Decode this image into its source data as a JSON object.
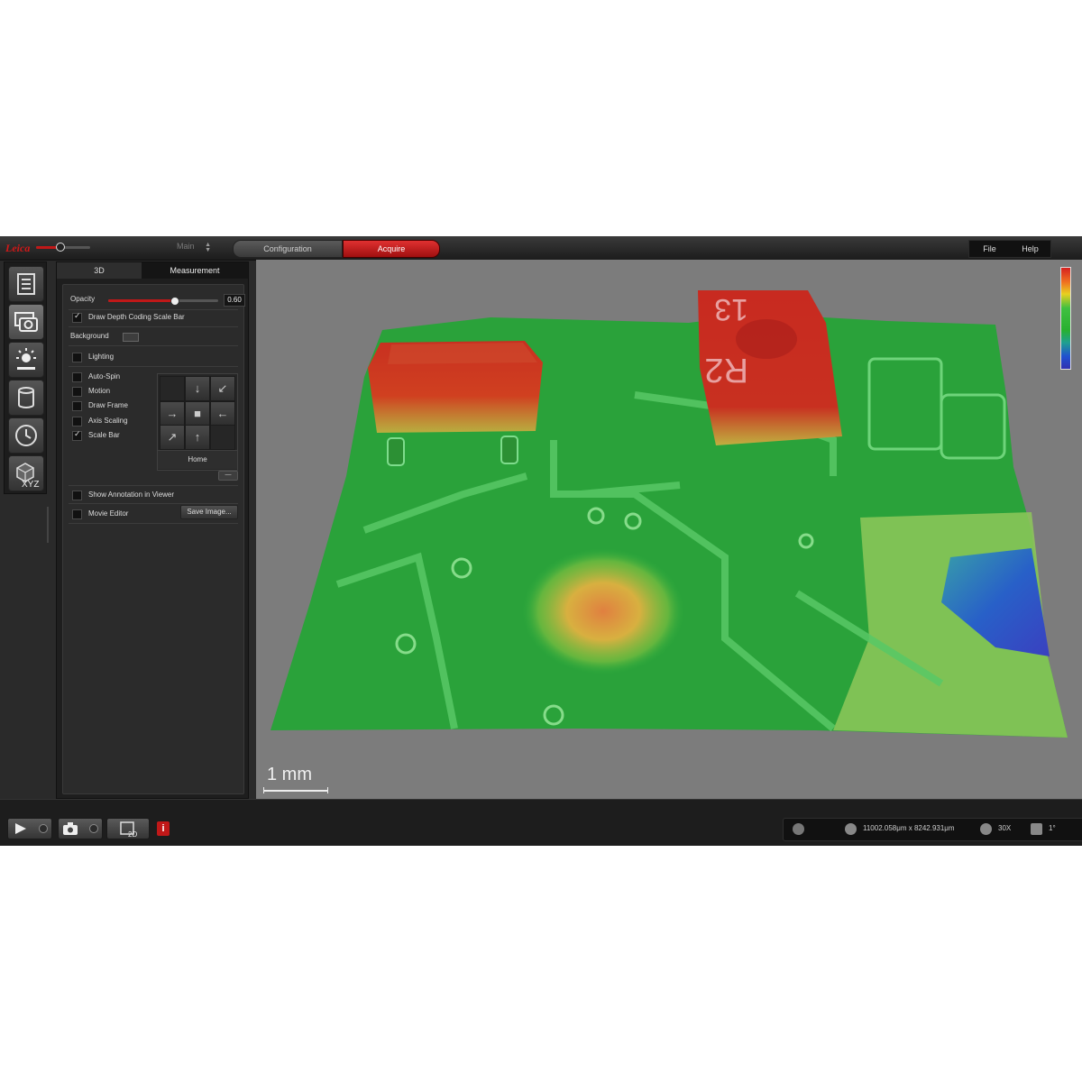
{
  "topbar": {
    "logo_text": "Leica",
    "main_select": "Main",
    "workflow": [
      "Configuration",
      "Acquire"
    ],
    "menu": [
      "File",
      "Help"
    ]
  },
  "left_toolbar": {
    "items": [
      "image-info-icon",
      "camera-icon",
      "illumination-icon",
      "cylinder-icon",
      "clock-icon",
      "xyz-cube-icon"
    ],
    "xyz_label": "XYZ",
    "active_index": 1
  },
  "panel": {
    "tabs": [
      "3D",
      "Measurement"
    ],
    "opacity": {
      "label": "Opacity",
      "value": "0.60",
      "fraction": 0.6
    },
    "draw_depth": {
      "label": "Draw Depth Coding Scale Bar",
      "checked": true
    },
    "background": {
      "label": "Background"
    },
    "lighting": {
      "label": "Lighting",
      "checked": false
    },
    "options": [
      {
        "label": "Auto-Spin",
        "checked": false
      },
      {
        "label": "Motion",
        "checked": false
      },
      {
        "label": "Draw Frame",
        "checked": false
      },
      {
        "label": "Axis Scaling",
        "checked": false
      },
      {
        "label": "Scale Bar",
        "checked": true
      }
    ],
    "home_label": "Home",
    "small_button": "—",
    "show_annotation": {
      "label": "Show Annotation in Viewer",
      "checked": false
    },
    "movie_editor": {
      "label": "Movie Editor",
      "checked": false
    },
    "save_image_label": "Save Image..."
  },
  "viewer": {
    "scale_bar_label": "1 mm",
    "component_labels": [
      "R2",
      "13"
    ],
    "depth_colors": [
      "#d62020",
      "#f07020",
      "#e8d020",
      "#40c040",
      "#20a090",
      "#2050d0"
    ]
  },
  "bottombar": {
    "play_icon": "play-icon",
    "snapshot_icon": "camera-icon",
    "view_mode": "2D",
    "info_icon": "info-icon",
    "dimensions": "11002.058μm x 8242.931μm",
    "zoom": "30X",
    "rotation": "1°"
  }
}
